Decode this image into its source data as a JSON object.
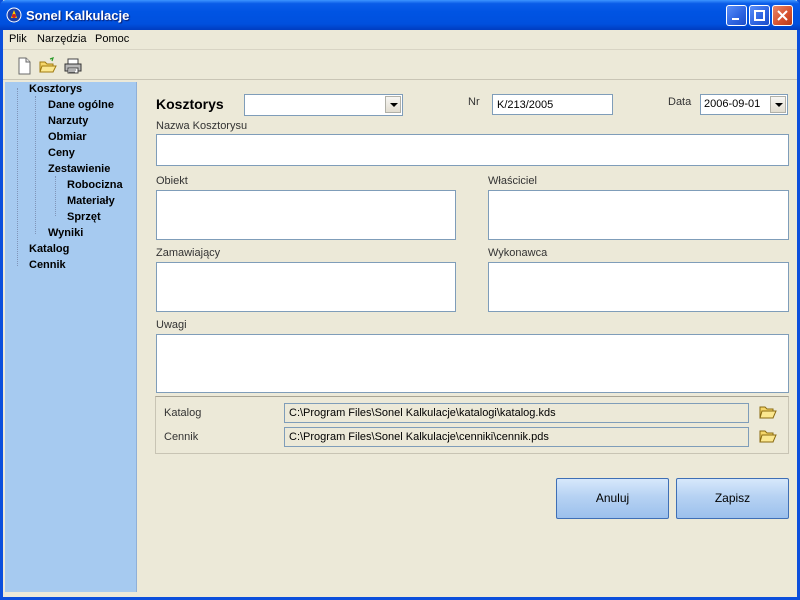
{
  "window": {
    "title": "Sonel Kalkulacje"
  },
  "menu": {
    "items": [
      "Plik",
      "Narzędzia",
      "Pomoc"
    ]
  },
  "toolbar": {
    "icons": [
      "new-document-icon",
      "open-folder-icon",
      "print-icon"
    ]
  },
  "tree": {
    "items": [
      {
        "label": "Kosztorys",
        "level": 0
      },
      {
        "label": "Dane ogólne",
        "level": 1
      },
      {
        "label": "Narzuty",
        "level": 1
      },
      {
        "label": "Obmiar",
        "level": 1
      },
      {
        "label": "Ceny",
        "level": 1
      },
      {
        "label": "Zestawienie",
        "level": 1
      },
      {
        "label": "Robocizna",
        "level": 2
      },
      {
        "label": "Materiały",
        "level": 2
      },
      {
        "label": "Sprzęt",
        "level": 2
      },
      {
        "label": "Wyniki",
        "level": 1
      },
      {
        "label": "Katalog",
        "level": 0
      },
      {
        "label": "Cennik",
        "level": 0
      }
    ]
  },
  "form": {
    "kosztorys_label": "Kosztorys",
    "kosztorys_value": "",
    "nr_label": "Nr",
    "nr_value": "K/213/2005",
    "data_label": "Data",
    "data_value": "2006-09-01",
    "nazwa_label": "Nazwa Kosztorysu",
    "nazwa_value": "",
    "obiekt_label": "Obiekt",
    "obiekt_value": "",
    "wlasciciel_label": "Właściciel",
    "wlasciciel_value": "",
    "zamawiajacy_label": "Zamawiający",
    "zamawiajacy_value": "",
    "wykonawca_label": "Wykonawca",
    "wykonawca_value": "",
    "uwagi_label": "Uwagi",
    "uwagi_value": "",
    "katalog_label": "Katalog",
    "katalog_path": "C:\\Program Files\\Sonel Kalkulacje\\katalogi\\katalog.kds",
    "cennik_label": "Cennik",
    "cennik_path": "C:\\Program Files\\Sonel Kalkulacje\\cenniki\\cennik.pds"
  },
  "buttons": {
    "cancel": "Anuluj",
    "save": "Zapisz"
  },
  "colors": {
    "titlebar": "#0054e3",
    "sidebar": "#a6caf0",
    "window_bg": "#ece9d8"
  }
}
